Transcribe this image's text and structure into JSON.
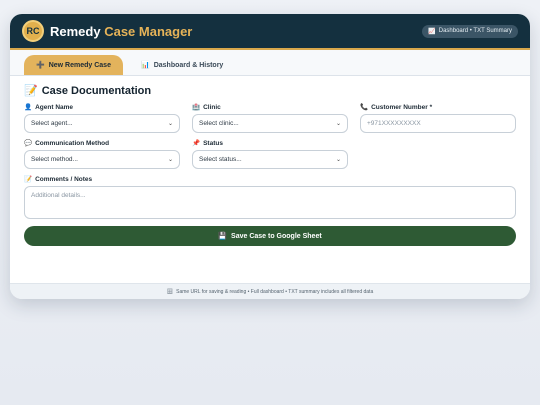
{
  "header": {
    "logo_text": "RC",
    "title_main": "Remedy",
    "title_accent": "Case Manager",
    "badge_icon": "📈",
    "badge_text": "Dashboard • TXT Summary"
  },
  "tabs": [
    {
      "icon": "➕",
      "label": "New Remedy Case"
    },
    {
      "icon": "📊",
      "label": "Dashboard & History"
    }
  ],
  "section": {
    "icon": "📝",
    "title": "Case Documentation"
  },
  "fields": {
    "agent": {
      "icon": "👤",
      "label": "Agent Name",
      "value": "Select agent..."
    },
    "clinic": {
      "icon": "🏥",
      "label": "Clinic",
      "value": "Select clinic..."
    },
    "customer": {
      "icon": "📞",
      "label": "Customer Number *",
      "placeholder": "+971XXXXXXXXX"
    },
    "method": {
      "icon": "💬",
      "label": "Communication Method",
      "value": "Select method..."
    },
    "status": {
      "icon": "📌",
      "label": "Status",
      "value": "Select status..."
    },
    "comments": {
      "icon": "📝",
      "label": "Comments / Notes",
      "placeholder": "Additional details..."
    }
  },
  "save_button": {
    "icon": "💾",
    "label": "Save Case to Google Sheet"
  },
  "footer": {
    "icon": "🗄",
    "text": "Same URL for saving & reading • Full dashboard • TXT summary includes all filtered data"
  },
  "colors": {
    "header_bg": "#14303f",
    "accent": "#e3b35c",
    "save_button": "#2e5a34"
  }
}
